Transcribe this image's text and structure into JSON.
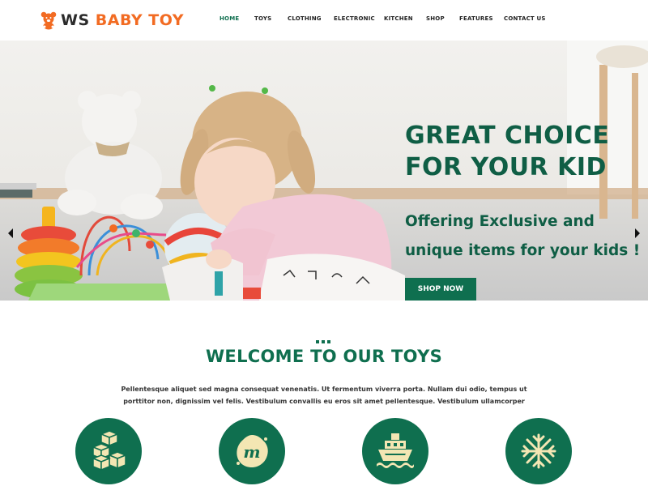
{
  "brand": {
    "prefix": "WS",
    "name": "BABY TOY"
  },
  "nav": {
    "items": [
      {
        "label": "HOME",
        "active": true
      },
      {
        "label": "TOYS"
      },
      {
        "label": "CLOTHING"
      },
      {
        "label": "ELECTRONIC"
      },
      {
        "label": "KITCHEN"
      },
      {
        "label": "SHOP"
      },
      {
        "label": "FEATURES"
      },
      {
        "label": "CONTACT US"
      }
    ]
  },
  "hero": {
    "title": "GREAT CHOICE FOR YOUR KID",
    "subtitle": "Offering Exclusive and unique items for your kids !",
    "button": "SHOP NOW"
  },
  "welcome": {
    "title": "WELCOME TO OUR TOYS",
    "text": "Pellentesque aliquet sed magna consequat venenatis. Ut fermentum viverra porta. Nullam dui odio, tempus ut porttitor non, dignissim vel felis. Vestibulum convallis eu eros sit amet pellentesque. Vestibulum ullamcorper"
  },
  "features": [
    {
      "icon": "blocks-icon"
    },
    {
      "icon": "badge-m-icon"
    },
    {
      "icon": "ship-icon"
    },
    {
      "icon": "snowflake-icon"
    }
  ],
  "colors": {
    "accent": "#0f6f4f",
    "brand_orange": "#f26b22",
    "icon_cream": "#f3e6b3"
  }
}
